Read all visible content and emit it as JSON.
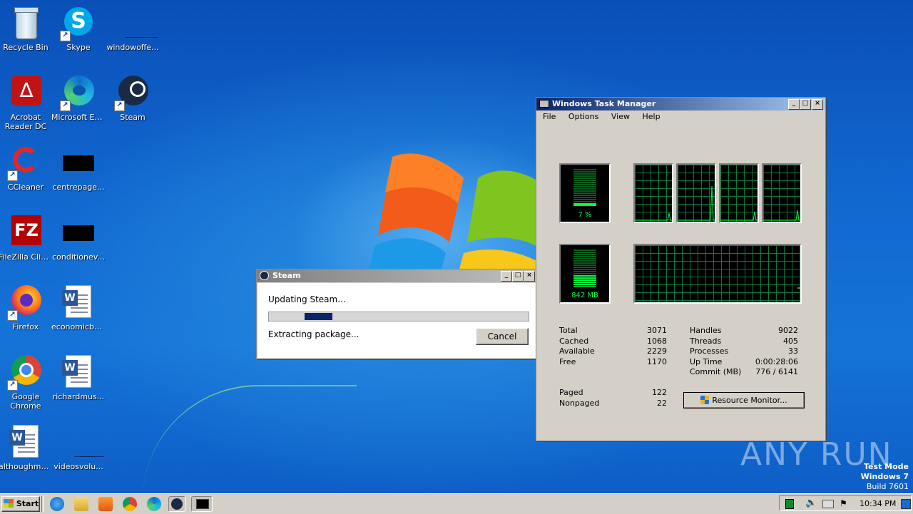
{
  "desktop": {
    "icons": [
      {
        "label": "Recycle Bin"
      },
      {
        "label": "Skype"
      },
      {
        "label": "windowoffe..."
      },
      {
        "label": "Acrobat Reader DC"
      },
      {
        "label": "Microsoft Edge"
      },
      {
        "label": "Steam"
      },
      {
        "label": "CCleaner"
      },
      {
        "label": "centrepage..."
      },
      {
        "label": "FileZilla Client"
      },
      {
        "label": "conditionev..."
      },
      {
        "label": "Firefox"
      },
      {
        "label": "economicbo..."
      },
      {
        "label": "Google Chrome"
      },
      {
        "label": "richardmus..."
      },
      {
        "label": "althoughme..."
      },
      {
        "label": "videosvolu..."
      }
    ],
    "watermark": "ANY RUN",
    "test_mode": {
      "line1": "Test Mode",
      "line2": "Windows 7",
      "line3": "Build 7601"
    }
  },
  "steam_dialog": {
    "title": "Steam",
    "status": "Updating Steam...",
    "detail": "Extracting package...",
    "cancel_label": "Cancel",
    "progress_fraction": 0.14
  },
  "task_manager": {
    "title": "Windows Task Manager",
    "menu": [
      "File",
      "Options",
      "View",
      "Help"
    ],
    "cpu_usage": "7 %",
    "memory_usage": "842 MB",
    "physical_memory": [
      {
        "label": "Total",
        "value": "3071"
      },
      {
        "label": "Cached",
        "value": "1068"
      },
      {
        "label": "Available",
        "value": "2229"
      },
      {
        "label": "Free",
        "value": "1170"
      }
    ],
    "system": [
      {
        "label": "Handles",
        "value": "9022"
      },
      {
        "label": "Threads",
        "value": "405"
      },
      {
        "label": "Processes",
        "value": "33"
      },
      {
        "label": "Up Time",
        "value": "0:00:28:06"
      },
      {
        "label": "Commit (MB)",
        "value": "776 / 6141"
      }
    ],
    "kernel_memory": [
      {
        "label": "Paged",
        "value": "122"
      },
      {
        "label": "Nonpaged",
        "value": "22"
      }
    ],
    "resource_monitor_label": "Resource Monitor..."
  },
  "taskbar": {
    "start_label": "Start",
    "clock": "10:34 PM"
  },
  "colors": {
    "title_active": "#0a246a",
    "title_gradient_end": "#a6caf0",
    "title_inactive": "#808080",
    "graph_green": "#00ff40",
    "progress_fill": "#0a246a"
  }
}
